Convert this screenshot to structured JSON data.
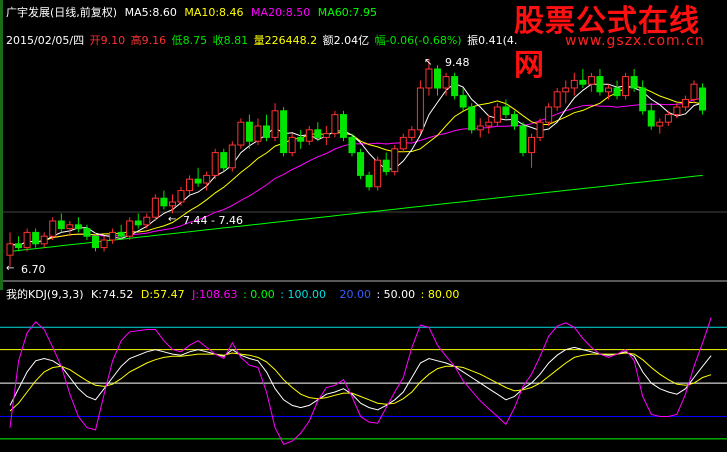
{
  "header": {
    "title": "广宇发展(日线,前复权)",
    "ma5_label": "MA5:",
    "ma5": "8.60",
    "ma10_label": "MA10:",
    "ma10": "8.46",
    "ma20_label": "MA20:",
    "ma20": "8.50",
    "ma60_label": "MA60:",
    "ma60": "7.95"
  },
  "info": {
    "date": "2015/02/05/四",
    "open_label": "开",
    "open": "9.10",
    "high_label": "高",
    "high": "9.16",
    "low_label": "低",
    "low": "8.75",
    "close_label": "收",
    "close": "8.81",
    "vol_label": "量",
    "vol": "226448.2",
    "amt_label": "额",
    "amt": "2.04亿",
    "chg_label": "幅",
    "chg": "-0.06(-0.68%)",
    "amp_label": "振",
    "amp": "0.41(4."
  },
  "watermark": {
    "line1": "股票公式在线网",
    "line2": "www.gszx.com.cn"
  },
  "annotations": {
    "high_mark": "9.48",
    "low_mark": "6.70",
    "range_mark": "7.44 - 7.46"
  },
  "kdj": {
    "name": "我的KDJ(9,3,3)",
    "k_label": "K:",
    "k": "74.52",
    "d_label": "D:",
    "d": "57.47",
    "j_label": "J:",
    "j": "108.63",
    "lvl0": ": 0.00",
    "lvl100": ": 100.00",
    "lvl20": "20.00",
    "lvl50": ": 50.00",
    "lvl80": ": 80.00"
  },
  "colors": {
    "up": "#ff3232",
    "down": "#00e600",
    "ma5": "#ffffff",
    "ma10": "#ffff00",
    "ma20": "#ff00ff",
    "ma60": "#00ff00",
    "k": "#ffffff",
    "d": "#ffff00",
    "j": "#ff00ff",
    "cyan": "#00e0e0",
    "blue": "#0000ff"
  },
  "chart_data": [
    {
      "type": "candlestick",
      "y_range": [
        6.6,
        9.6
      ],
      "candles": [
        [
          6.9,
          7.2,
          6.75,
          7.05
        ],
        [
          7.05,
          7.15,
          6.95,
          7.0
        ],
        [
          7.0,
          7.25,
          6.95,
          7.2
        ],
        [
          7.2,
          7.25,
          7.0,
          7.05
        ],
        [
          7.05,
          7.2,
          7.0,
          7.15
        ],
        [
          7.15,
          7.4,
          7.1,
          7.35
        ],
        [
          7.35,
          7.45,
          7.2,
          7.25
        ],
        [
          7.25,
          7.35,
          7.15,
          7.3
        ],
        [
          7.3,
          7.4,
          7.2,
          7.25
        ],
        [
          7.25,
          7.3,
          7.1,
          7.15
        ],
        [
          7.15,
          7.2,
          6.95,
          7.0
        ],
        [
          7.0,
          7.15,
          6.95,
          7.1
        ],
        [
          7.1,
          7.25,
          7.05,
          7.2
        ],
        [
          7.2,
          7.3,
          7.1,
          7.15
        ],
        [
          7.15,
          7.4,
          7.1,
          7.35
        ],
        [
          7.35,
          7.45,
          7.25,
          7.3
        ],
        [
          7.3,
          7.45,
          7.25,
          7.4
        ],
        [
          7.4,
          7.7,
          7.35,
          7.65
        ],
        [
          7.65,
          7.75,
          7.5,
          7.55
        ],
        [
          7.55,
          7.7,
          7.45,
          7.6
        ],
        [
          7.6,
          7.8,
          7.55,
          7.75
        ],
        [
          7.75,
          7.95,
          7.7,
          7.9
        ],
        [
          7.9,
          8.05,
          7.8,
          7.85
        ],
        [
          7.85,
          8.0,
          7.75,
          7.95
        ],
        [
          7.95,
          8.3,
          7.9,
          8.25
        ],
        [
          8.25,
          8.3,
          8.0,
          8.05
        ],
        [
          8.05,
          8.4,
          8.0,
          8.35
        ],
        [
          8.35,
          8.7,
          8.3,
          8.65
        ],
        [
          8.65,
          8.75,
          8.3,
          8.4
        ],
        [
          8.4,
          8.7,
          8.35,
          8.6
        ],
        [
          8.6,
          8.75,
          8.4,
          8.45
        ],
        [
          8.45,
          8.9,
          8.4,
          8.8
        ],
        [
          8.8,
          8.85,
          8.2,
          8.25
        ],
        [
          8.25,
          8.5,
          8.2,
          8.45
        ],
        [
          8.45,
          8.55,
          8.3,
          8.4
        ],
        [
          8.4,
          8.6,
          8.35,
          8.55
        ],
        [
          8.55,
          8.65,
          8.4,
          8.45
        ],
        [
          8.45,
          8.6,
          8.35,
          8.5
        ],
        [
          8.5,
          8.8,
          8.45,
          8.75
        ],
        [
          8.75,
          8.8,
          8.4,
          8.45
        ],
        [
          8.45,
          8.5,
          8.2,
          8.25
        ],
        [
          8.25,
          8.3,
          7.9,
          7.95
        ],
        [
          7.95,
          8.0,
          7.75,
          7.8
        ],
        [
          7.8,
          8.2,
          7.75,
          8.15
        ],
        [
          8.15,
          8.25,
          7.95,
          8.0
        ],
        [
          8.0,
          8.35,
          7.95,
          8.3
        ],
        [
          8.3,
          8.5,
          8.25,
          8.45
        ],
        [
          8.45,
          8.6,
          8.4,
          8.55
        ],
        [
          8.55,
          9.2,
          8.5,
          9.1
        ],
        [
          9.1,
          9.48,
          9.0,
          9.35
        ],
        [
          9.35,
          9.4,
          9.0,
          9.1
        ],
        [
          9.1,
          9.3,
          9.0,
          9.25
        ],
        [
          9.25,
          9.3,
          8.95,
          9.0
        ],
        [
          9.0,
          9.1,
          8.8,
          8.85
        ],
        [
          8.85,
          8.9,
          8.5,
          8.55
        ],
        [
          8.55,
          8.7,
          8.45,
          8.6
        ],
        [
          8.6,
          8.75,
          8.5,
          8.65
        ],
        [
          8.65,
          8.9,
          8.6,
          8.85
        ],
        [
          8.85,
          8.95,
          8.7,
          8.75
        ],
        [
          8.75,
          8.8,
          8.55,
          8.6
        ],
        [
          8.6,
          8.65,
          8.2,
          8.25
        ],
        [
          8.25,
          8.5,
          8.05,
          8.45
        ],
        [
          8.45,
          8.7,
          8.4,
          8.65
        ],
        [
          8.65,
          8.9,
          8.6,
          8.85
        ],
        [
          8.85,
          9.1,
          8.8,
          9.05
        ],
        [
          9.05,
          9.2,
          8.9,
          9.1
        ],
        [
          9.1,
          9.3,
          9.0,
          9.2
        ],
        [
          9.2,
          9.35,
          9.1,
          9.15
        ],
        [
          9.15,
          9.3,
          9.05,
          9.25
        ],
        [
          9.25,
          9.35,
          9.0,
          9.05
        ],
        [
          9.05,
          9.15,
          8.95,
          9.1
        ],
        [
          9.1,
          9.2,
          8.95,
          9.0
        ],
        [
          9.0,
          9.3,
          8.95,
          9.25
        ],
        [
          9.25,
          9.35,
          9.05,
          9.1
        ],
        [
          9.1,
          9.2,
          8.75,
          8.8
        ],
        [
          8.8,
          8.9,
          8.55,
          8.6
        ],
        [
          8.6,
          8.7,
          8.5,
          8.65
        ],
        [
          8.65,
          8.8,
          8.6,
          8.75
        ],
        [
          8.75,
          8.9,
          8.7,
          8.85
        ],
        [
          8.85,
          9.0,
          8.8,
          8.95
        ],
        [
          8.95,
          9.2,
          8.9,
          9.15
        ],
        [
          9.1,
          9.16,
          8.75,
          8.81
        ]
      ]
    },
    {
      "type": "line",
      "name": "我的KDJ(9,3,3)",
      "y_range": [
        -10,
        120
      ],
      "levels": [
        0,
        20,
        50,
        80,
        100
      ],
      "series": [
        {
          "name": "K",
          "values": [
            30,
            45,
            60,
            70,
            72,
            70,
            65,
            55,
            45,
            38,
            35,
            45,
            55,
            65,
            72,
            75,
            78,
            80,
            78,
            76,
            75,
            78,
            80,
            78,
            76,
            74,
            80,
            75,
            72,
            70,
            60,
            45,
            35,
            30,
            28,
            30,
            35,
            40,
            42,
            45,
            40,
            32,
            28,
            26,
            30,
            35,
            42,
            55,
            68,
            72,
            70,
            68,
            65,
            60,
            55,
            50,
            45,
            40,
            35,
            38,
            45,
            50,
            58,
            68,
            75,
            80,
            82,
            80,
            78,
            76,
            75,
            76,
            78,
            74,
            60,
            50,
            45,
            42,
            40,
            45,
            55,
            65,
            74.52
          ]
        },
        {
          "name": "D",
          "values": [
            25,
            32,
            42,
            52,
            60,
            64,
            65,
            62,
            57,
            52,
            48,
            47,
            49,
            54,
            60,
            64,
            68,
            71,
            73,
            74,
            74,
            75,
            76,
            76,
            76,
            75,
            77,
            76,
            75,
            73,
            69,
            62,
            53,
            46,
            40,
            37,
            36,
            37,
            39,
            41,
            41,
            38,
            35,
            32,
            31,
            32,
            36,
            42,
            51,
            58,
            63,
            65,
            65,
            64,
            61,
            58,
            54,
            50,
            46,
            43,
            44,
            46,
            50,
            56,
            62,
            68,
            73,
            75,
            76,
            76,
            76,
            76,
            77,
            76,
            71,
            64,
            58,
            53,
            49,
            48,
            50,
            55,
            57.47
          ]
        },
        {
          "name": "J",
          "values": [
            10,
            70,
            95,
            105,
            98,
            82,
            65,
            40,
            20,
            10,
            8,
            40,
            70,
            88,
            96,
            97,
            98,
            98,
            88,
            80,
            78,
            84,
            88,
            82,
            76,
            72,
            86,
            73,
            66,
            64,
            42,
            10,
            -5,
            -2,
            5,
            16,
            34,
            46,
            48,
            53,
            38,
            20,
            15,
            14,
            28,
            42,
            55,
            82,
            102,
            100,
            84,
            74,
            65,
            52,
            43,
            34,
            27,
            20,
            13,
            28,
            47,
            58,
            74,
            92,
            101,
            104,
            100,
            90,
            82,
            76,
            73,
            76,
            80,
            70,
            38,
            22,
            20,
            20,
            22,
            40,
            65,
            86,
            108.63
          ]
        }
      ]
    }
  ]
}
